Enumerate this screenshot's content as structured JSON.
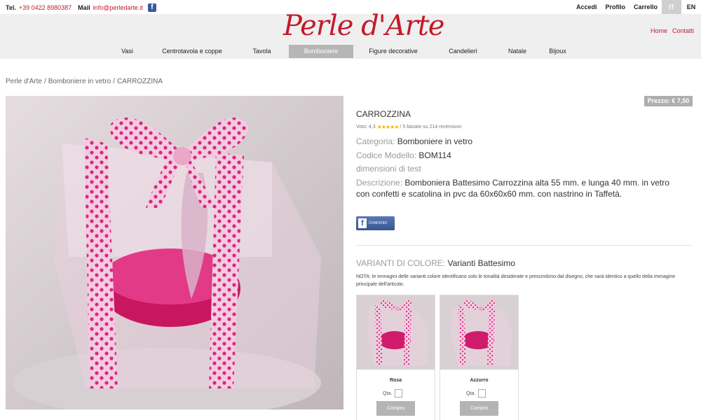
{
  "topbar": {
    "tel_label": "Tel.",
    "tel_value": "+39 0422 8980387",
    "mail_label": "Mail",
    "mail_value": "info@perledarte.it",
    "facebook_icon": "facebook-icon",
    "account_links": [
      "Accedi",
      "Profilo",
      "Carrello"
    ],
    "languages": [
      "IT",
      "EN"
    ],
    "active_language": "IT"
  },
  "header": {
    "logo_text": "Perle d'Arte",
    "logo_mark": "®",
    "side_links": [
      "Home",
      "Contatti"
    ],
    "brand_color": "#c21a2b"
  },
  "nav": {
    "items": [
      "Vasi",
      "Centrotavola e coppe",
      "Tavola",
      "Bomboniere",
      "Figure decorative",
      "Candelieri",
      "Natale",
      "Bijoux"
    ],
    "active": "Bomboniere"
  },
  "breadcrumb": {
    "items": [
      "Perle d'Arte",
      "Bomboniere in vetro",
      "CARROZZINA"
    ],
    "separator": "/"
  },
  "product": {
    "price": "Prezzo: € 7,50",
    "title": "CARROZZINA",
    "rating_prefix": "Voto: 4,3",
    "rating_suffix": "/ 5 basato su 214 recensioni",
    "rating_value": 4.3,
    "category_label": "Categoria:",
    "category_value": "Bomboniere in vetro",
    "model_label": "Codice Modello:",
    "model_value": "BOM114",
    "dimensions_label": "dimensioni di test",
    "description_label": "Descrizione:",
    "description_value": "Bomboniera Battesimo Carrozzina alta 55 mm. e lunga 40 mm. in vetro con confetti e scatolina in pvc da 60x60x60 mm. con nastrino in Taffetà.",
    "share_label": "CONDIVIDI"
  },
  "variants": {
    "title_label": "VARIANTI DI COLORE:",
    "title_value": "Varianti Battesimo",
    "note": "NOTA: le immagini delle varianti colore identificano solo le tonalità desiderate e prescindono dal disegno, che sarà identico a quello della immagine principale dell'articolo.",
    "qty_label": "Qta.",
    "buy_label": "Compra",
    "items": [
      {
        "name": "Rosa"
      },
      {
        "name": "Azzurro"
      }
    ]
  }
}
